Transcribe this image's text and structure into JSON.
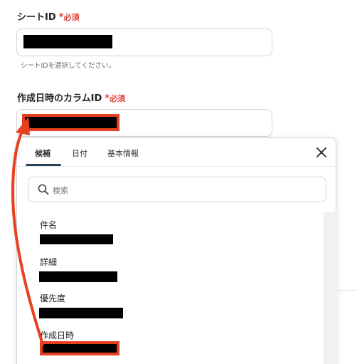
{
  "sheet_id": {
    "label": "シートID",
    "star": "*",
    "required": "必須",
    "hint": "シートIDを選択してください。"
  },
  "created_col": {
    "label": "作成日時のカラムID",
    "star": "*",
    "required": "必須"
  },
  "dropdown": {
    "tabs": [
      {
        "label": "候補"
      },
      {
        "label": "日付"
      },
      {
        "label": "基本情報"
      }
    ],
    "search_placeholder": "検索",
    "items": [
      {
        "label": "件名"
      },
      {
        "label": "詳細"
      },
      {
        "label": "優先度"
      },
      {
        "label": "作成日時"
      }
    ]
  },
  "colors": {
    "accent_red": "#e8401f",
    "required_red": "#e0413a",
    "tab_active": "#2b4458"
  },
  "icons": [
    "search-icon",
    "close-icon",
    "arrow-annotation"
  ]
}
